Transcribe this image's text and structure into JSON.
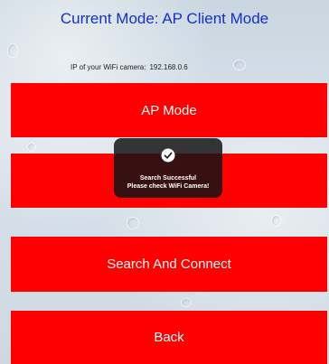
{
  "header": {
    "title": "Current Mode: AP Client Mode",
    "ip_label": "IP of your WiFi camera:",
    "ip_value": "192.168.0.6"
  },
  "buttons": {
    "ap_mode": "AP Mode",
    "station_mode": "",
    "search_connect": "Search And Connect",
    "back": "Back"
  },
  "toast": {
    "icon": "checkmark-icon",
    "line1": "Search Successful",
    "line2": "Please check WiFi Camera!"
  },
  "colors": {
    "accent_button": "#ff0000",
    "title_text": "#1530c8"
  }
}
